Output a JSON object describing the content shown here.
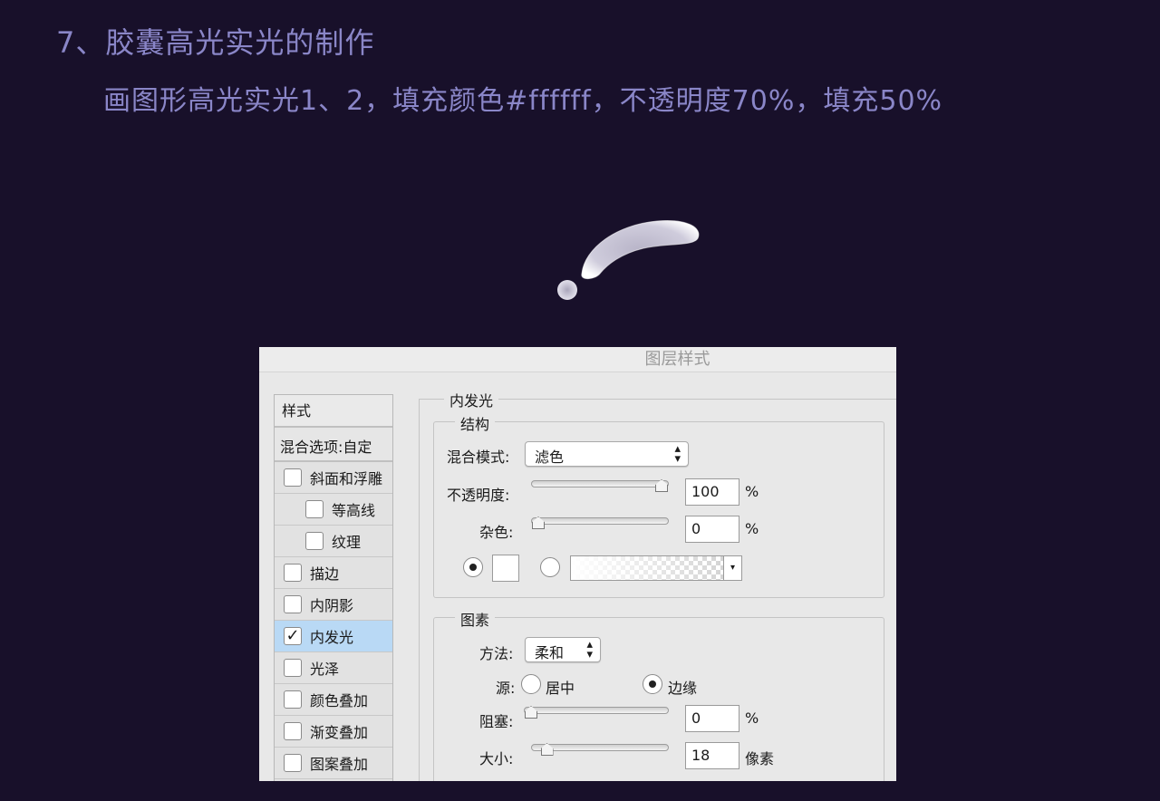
{
  "step_title": "7、胶囊高光实光的制作",
  "instruction": "画图形高光实光1、2，填充颜色#ffffff，不透明度70%，填充50%",
  "dialog": {
    "title": "图层样式",
    "sidebar": {
      "header": "样式",
      "blend_options": "混合选项:自定",
      "items": [
        {
          "label": "斜面和浮雕",
          "checked": false
        },
        {
          "label": "等高线",
          "checked": false
        },
        {
          "label": "纹理",
          "checked": false
        },
        {
          "label": "描边",
          "checked": false
        },
        {
          "label": "内阴影",
          "checked": false
        },
        {
          "label": "内发光",
          "checked": true
        },
        {
          "label": "光泽",
          "checked": false
        },
        {
          "label": "颜色叠加",
          "checked": false
        },
        {
          "label": "渐变叠加",
          "checked": false
        },
        {
          "label": "图案叠加",
          "checked": false
        }
      ]
    },
    "panel": {
      "title": "内发光",
      "structure": {
        "title": "结构",
        "blend_mode_label": "混合模式:",
        "blend_mode_value": "滤色",
        "opacity_label": "不透明度:",
        "opacity_value": "100",
        "opacity_unit": "%",
        "opacity_level": 1.0,
        "noise_label": "杂色:",
        "noise_value": "0",
        "noise_unit": "%",
        "noise_level": 0.0,
        "color_mode": "solid",
        "swatch_color": "#ffffff"
      },
      "elements": {
        "title": "图素",
        "method_label": "方法:",
        "method_value": "柔和",
        "source_label": "源:",
        "source_center": "居中",
        "source_edge": "边缘",
        "source_selected": "边缘",
        "choke_label": "阻塞:",
        "choke_value": "0",
        "choke_unit": "%",
        "choke_level": 0.0,
        "size_label": "大小:",
        "size_value": "18",
        "size_unit": "像素",
        "size_level": 0.07
      }
    }
  },
  "colors": {
    "background": "#18102a",
    "text_accent": "#8a86c8",
    "selected_row": "#b9d9f5"
  }
}
